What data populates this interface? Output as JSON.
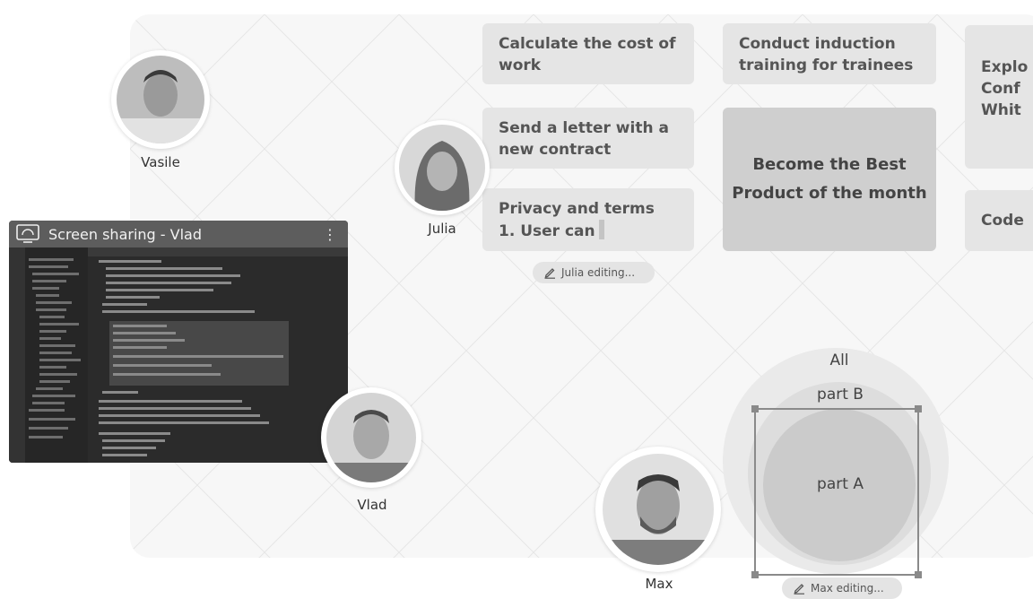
{
  "cards": {
    "cost": "Calculate the cost of work",
    "induction": "Conduct induction training for trainees",
    "explore": "Explo\nConf\nWhit",
    "letter": "Send a letter with a new contract",
    "privacy_line1": "Privacy and terms",
    "privacy_line2": "1. User can",
    "best_product": "Become the Best Product of the month",
    "code": "Code"
  },
  "editing": {
    "julia": "Julia editing...",
    "max": "Max editing..."
  },
  "users": {
    "vasile": "Vasile",
    "julia": "Julia",
    "vlad": "Vlad",
    "max": "Max"
  },
  "screen_share": {
    "title": "Screen sharing  - Vlad",
    "menu_icon": "more-vertical-icon"
  },
  "venn": {
    "all": "All",
    "part_b": "part B",
    "part_a": "part A"
  },
  "icons": {
    "edit": "pencil-icon"
  }
}
